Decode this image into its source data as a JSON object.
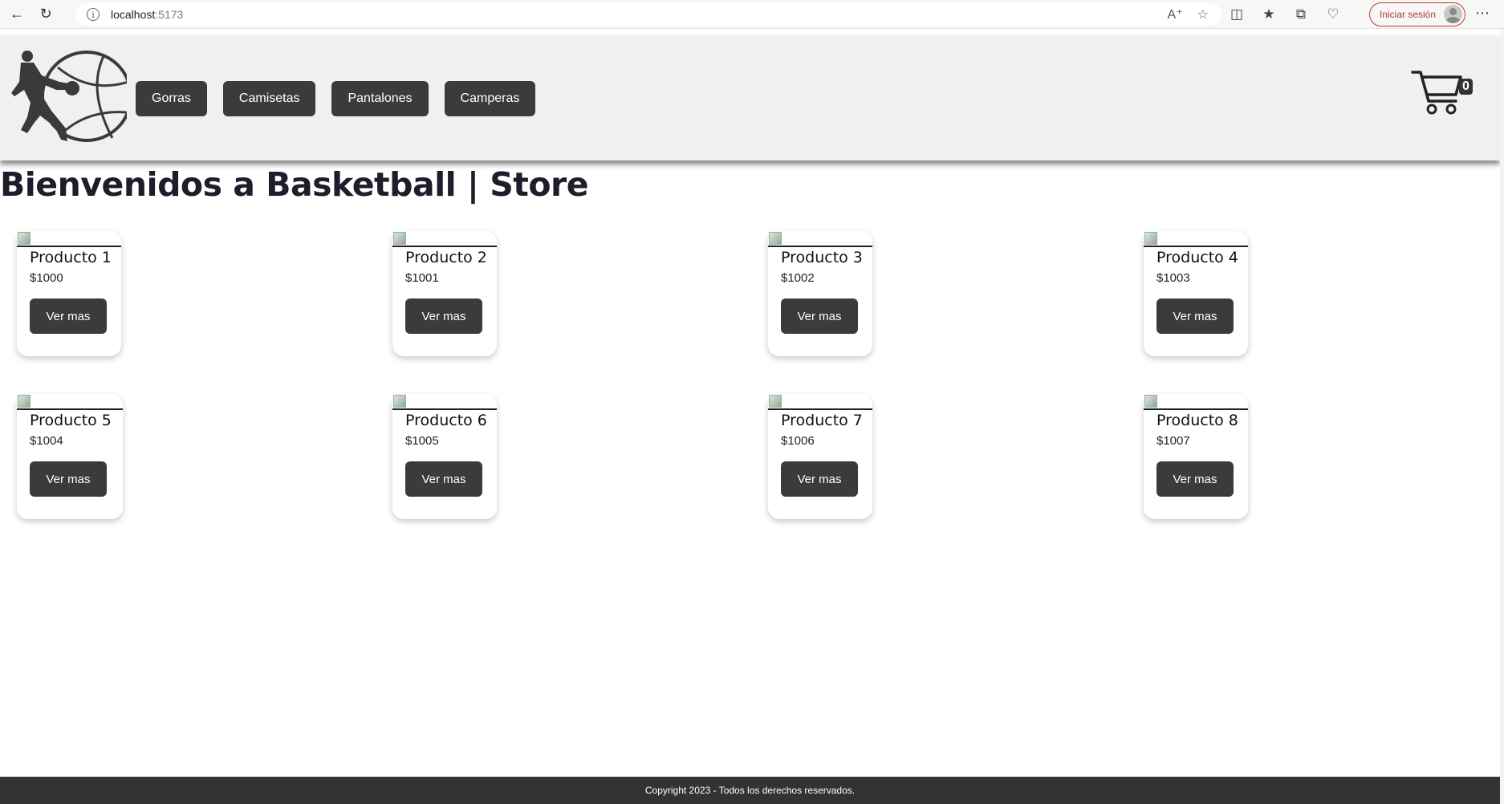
{
  "browser": {
    "url_host": "localhost",
    "url_port": ":5173",
    "signin_label": "Iniciar sesión"
  },
  "header": {
    "nav": [
      {
        "label": "Gorras"
      },
      {
        "label": "Camisetas"
      },
      {
        "label": "Pantalones"
      },
      {
        "label": "Camperas"
      }
    ],
    "cart_count": "0"
  },
  "main": {
    "title": "Bienvenidos a Basketball | Store",
    "products": [
      {
        "name": "Producto 1",
        "price": "$1000",
        "button": "Ver mas"
      },
      {
        "name": "Producto 2",
        "price": "$1001",
        "button": "Ver mas"
      },
      {
        "name": "Producto 3",
        "price": "$1002",
        "button": "Ver mas"
      },
      {
        "name": "Producto 4",
        "price": "$1003",
        "button": "Ver mas"
      },
      {
        "name": "Producto 5",
        "price": "$1004",
        "button": "Ver mas"
      },
      {
        "name": "Producto 6",
        "price": "$1005",
        "button": "Ver mas"
      },
      {
        "name": "Producto 7",
        "price": "$1006",
        "button": "Ver mas"
      },
      {
        "name": "Producto 8",
        "price": "$1007",
        "button": "Ver mas"
      }
    ]
  },
  "footer": {
    "text": "Copyright 2023 - Todos los derechos reservados."
  }
}
